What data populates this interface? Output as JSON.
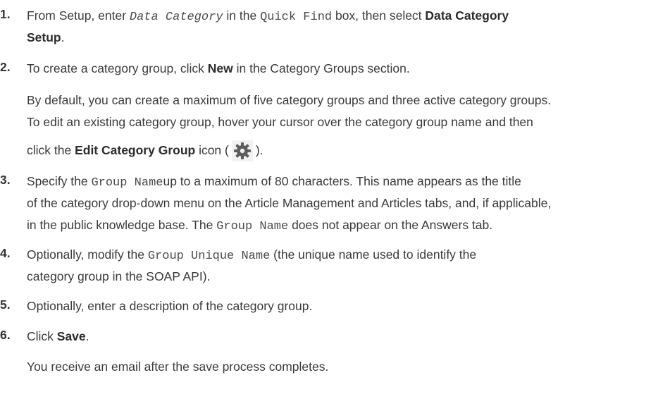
{
  "steps": [
    {
      "number": "1.",
      "line1": {
        "a": "From Setup, enter ",
        "code1": "Data Category",
        "b": " in the ",
        "code2": "Quick Find",
        "c": " box, then select ",
        "bold": "Data Category"
      },
      "line2": {
        "bold": "Setup",
        "end": "."
      }
    },
    {
      "number": "2.",
      "line1": {
        "a": "To create a category group, click ",
        "bold": "New",
        "b": " in the Category Groups section."
      },
      "para1": "By default, you can create a maximum of five category groups and three active category groups.",
      "para2": "To edit an existing category group, hover your cursor over the category group name and then",
      "para3": {
        "a": "click the ",
        "bold": "Edit Category Group",
        "b": " icon (",
        "icon": "gear-icon",
        "c": ")."
      }
    },
    {
      "number": "3.",
      "line1": {
        "a": "Specify the ",
        "code": "Group Name",
        "b": "up to a maximum of 80 characters. This name appears as the title"
      },
      "line2": "of the category drop-down menu on the Article Management and Articles tabs, and, if applicable,",
      "line3": {
        "a": "in the public knowledge base. The ",
        "code": "Group Name",
        "b": " does not appear on the Answers tab."
      }
    },
    {
      "number": "4.",
      "line1": {
        "a": "Optionally, modify the ",
        "code": "Group Unique Name",
        "b": " (the unique name used to identify the"
      },
      "line2": "category group in the SOAP API)."
    },
    {
      "number": "5.",
      "line1": "Optionally, enter a description of the category group."
    },
    {
      "number": "6.",
      "line1": {
        "a": "Click ",
        "bold": "Save",
        "b": "."
      },
      "para1": "You receive an email after the save process completes."
    }
  ]
}
